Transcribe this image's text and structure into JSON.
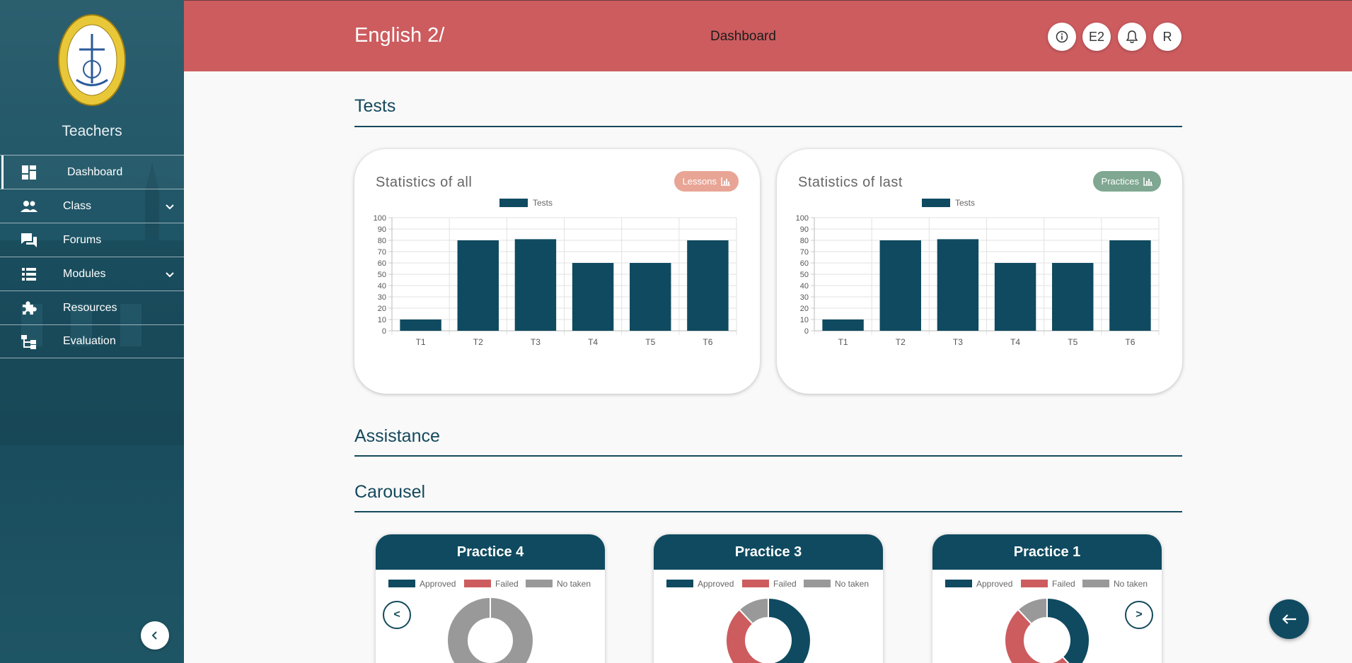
{
  "sidebar": {
    "role": "Teachers",
    "items": [
      {
        "label": "Dashboard",
        "icon": "dashboard-icon",
        "active": true
      },
      {
        "label": "Class",
        "icon": "people-icon",
        "expandable": true
      },
      {
        "label": "Forums",
        "icon": "forum-icon"
      },
      {
        "label": "Modules",
        "icon": "list-icon",
        "expandable": true
      },
      {
        "label": "Resources",
        "icon": "puzzle-icon"
      },
      {
        "label": "Evaluation",
        "icon": "hierarchy-icon"
      }
    ],
    "collapse_label": "‹"
  },
  "header": {
    "course_title": "English 2/",
    "page_label": "Dashboard",
    "buttons": {
      "info": "ⓘ",
      "course": "E2",
      "bell": "bell",
      "user": "R"
    }
  },
  "sections": {
    "tests": "Tests",
    "assistance": "Assistance",
    "carousel": "Carousel"
  },
  "cards": {
    "all": {
      "title": "Statistics of all",
      "badge": "Lessons",
      "badge_color": "#e8a596"
    },
    "last": {
      "title": "Statistics of last",
      "badge": "Practices",
      "badge_color": "#7fa791"
    }
  },
  "chart_data": [
    {
      "type": "bar",
      "legend": "Tests",
      "categories": [
        "T1",
        "T2",
        "T3",
        "T4",
        "T5",
        "T6"
      ],
      "values": [
        10,
        80,
        81,
        60,
        60,
        80
      ],
      "ylim": [
        0,
        100
      ],
      "yticks": [
        0,
        10,
        20,
        30,
        40,
        50,
        60,
        70,
        80,
        90,
        100
      ],
      "color": "#0f4a60",
      "grid": true,
      "legend_position": "top"
    },
    {
      "type": "bar",
      "legend": "Tests",
      "categories": [
        "T1",
        "T2",
        "T3",
        "T4",
        "T5",
        "T6"
      ],
      "values": [
        10,
        80,
        81,
        60,
        60,
        80
      ],
      "ylim": [
        0,
        100
      ],
      "yticks": [
        0,
        10,
        20,
        30,
        40,
        50,
        60,
        70,
        80,
        90,
        100
      ],
      "color": "#0f4a60",
      "grid": true,
      "legend_position": "top"
    },
    {
      "type": "pie",
      "title": "Practice 4",
      "labels": [
        "Approved",
        "Failed",
        "No taken"
      ],
      "values": [
        0,
        0,
        100
      ],
      "colors": [
        "#0f4a60",
        "#cd5c5f",
        "#999999"
      ]
    },
    {
      "type": "pie",
      "title": "Practice 3",
      "labels": [
        "Approved",
        "Failed",
        "No taken"
      ],
      "values": [
        46,
        42,
        12
      ],
      "colors": [
        "#0f4a60",
        "#cd5c5f",
        "#999999"
      ]
    },
    {
      "type": "pie",
      "title": "Practice 1",
      "labels": [
        "Approved",
        "Failed",
        "No taken"
      ],
      "values": [
        38,
        50,
        12
      ],
      "colors": [
        "#0f4a60",
        "#cd5c5f",
        "#999999"
      ]
    }
  ],
  "carousel": {
    "prev_label": "<",
    "next_label": ">"
  }
}
